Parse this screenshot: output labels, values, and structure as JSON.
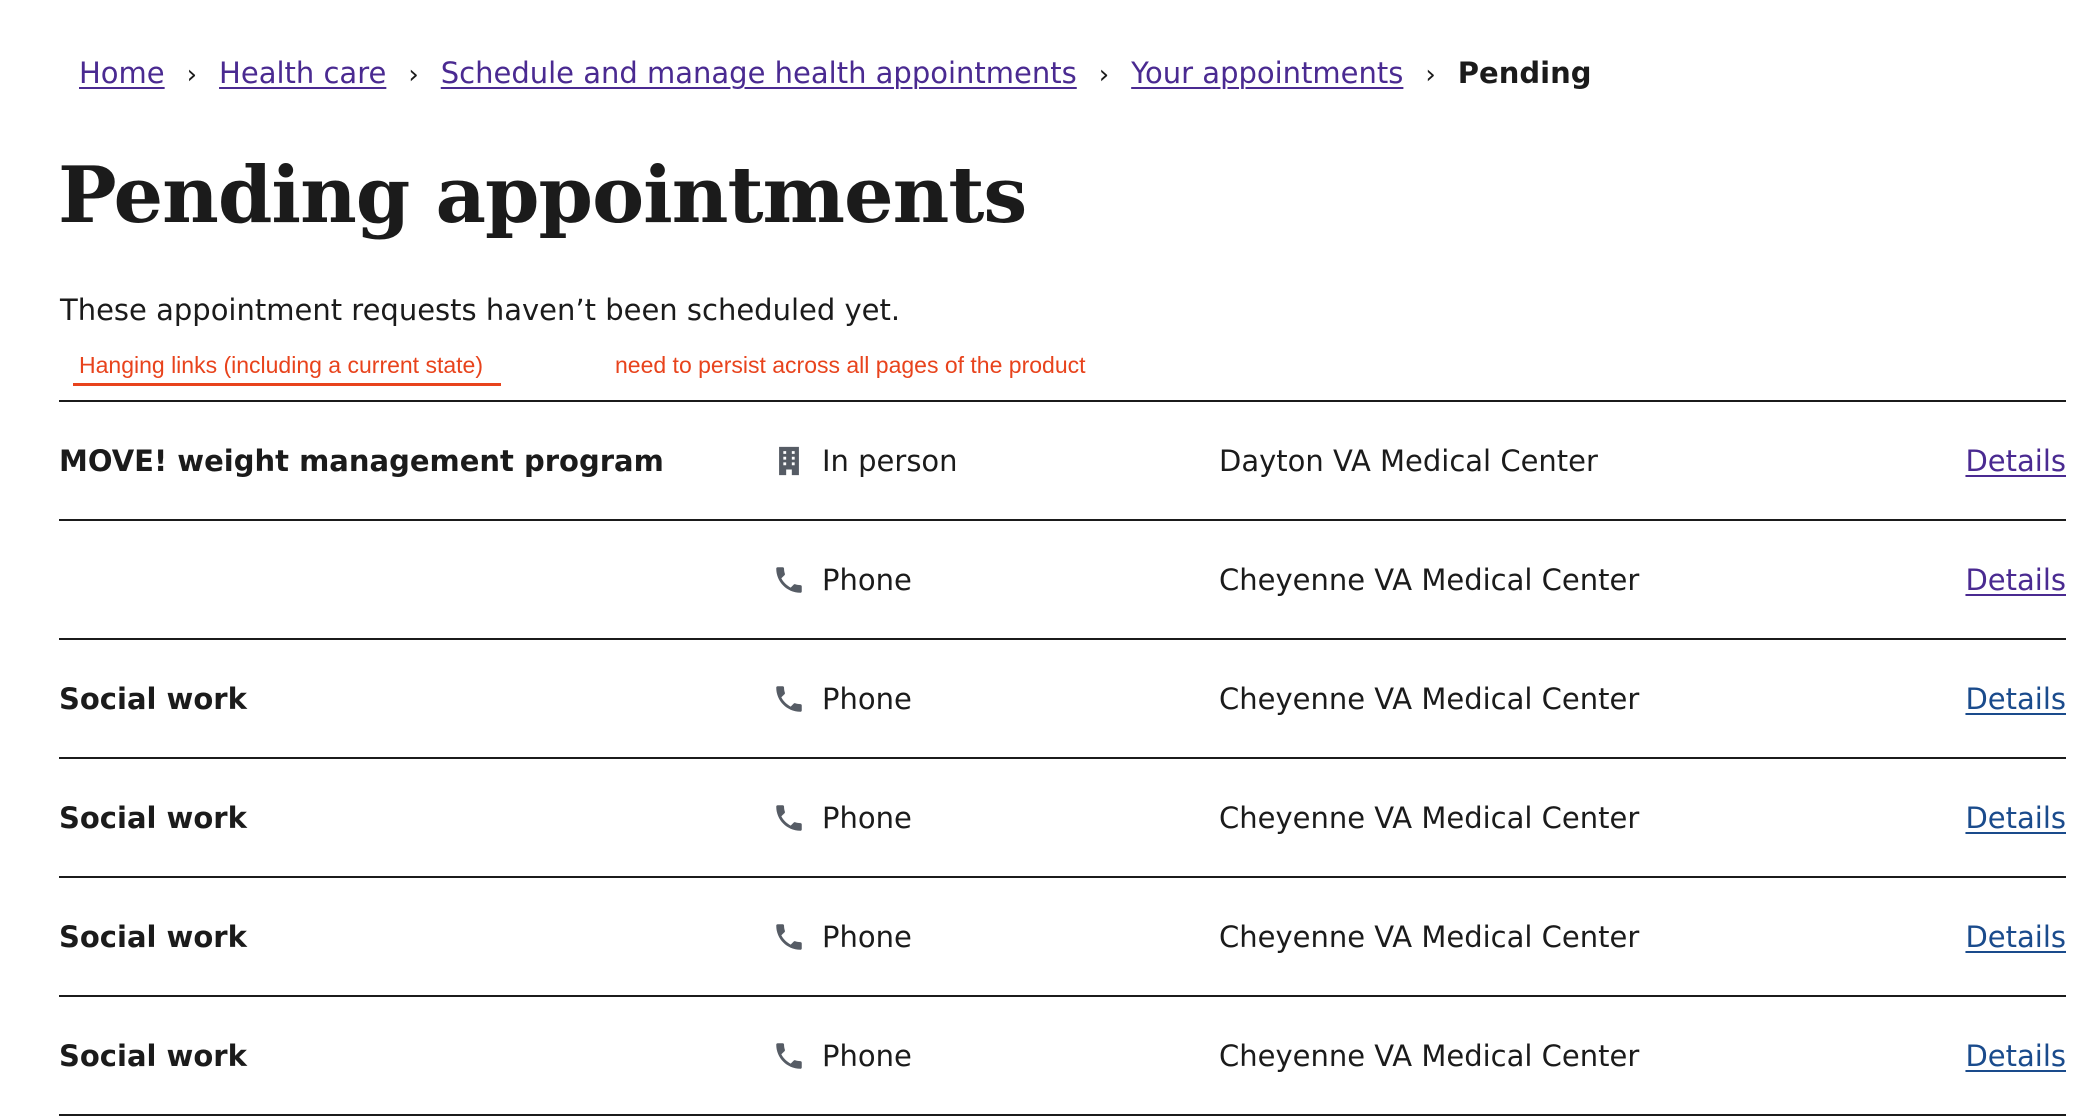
{
  "breadcrumb": {
    "items": [
      {
        "label": "Home"
      },
      {
        "label": "Health care"
      },
      {
        "label": "Schedule and manage health appointments"
      },
      {
        "label": "Your appointments"
      }
    ],
    "separator": "›",
    "current": "Pending"
  },
  "page": {
    "title": "Pending appointments",
    "intro": "These appointment requests haven’t been scheduled yet."
  },
  "annotations": {
    "note_1": "Hanging links (including a current state)",
    "note_2": "need to persist across all pages of the product",
    "color": "#e8431c"
  },
  "colors": {
    "link_visited": "#4a2a91",
    "link": "#1a4b8c",
    "text": "#1b1b1b",
    "icon": "#565c65"
  },
  "appointments": [
    {
      "type": "MOVE! weight management program",
      "modality": "In person",
      "modality_icon": "building-icon",
      "location": "Dayton VA Medical Center",
      "link": "Details"
    },
    {
      "type": "",
      "modality": "Phone",
      "modality_icon": "phone-icon",
      "location": "Cheyenne VA Medical Center",
      "link": "Details"
    },
    {
      "type": "Social work",
      "modality": "Phone",
      "modality_icon": "phone-icon",
      "location": "Cheyenne VA Medical Center",
      "link": "Details"
    },
    {
      "type": "Social work",
      "modality": "Phone",
      "modality_icon": "phone-icon",
      "location": "Cheyenne VA Medical Center",
      "link": "Details"
    },
    {
      "type": "Social work",
      "modality": "Phone",
      "modality_icon": "phone-icon",
      "location": "Cheyenne VA Medical Center",
      "link": "Details"
    },
    {
      "type": "Social work",
      "modality": "Phone",
      "modality_icon": "phone-icon",
      "location": "Cheyenne VA Medical Center",
      "link": "Details"
    }
  ]
}
